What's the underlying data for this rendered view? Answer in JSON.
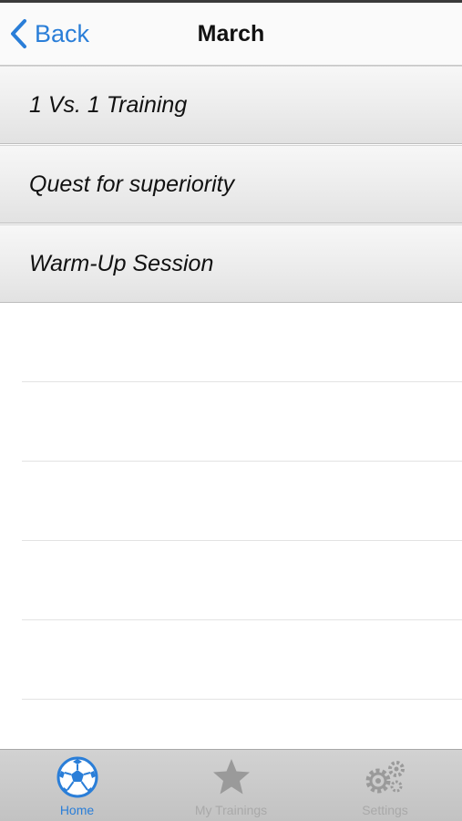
{
  "navbar": {
    "back_label": "Back",
    "title": "March"
  },
  "list": {
    "items": [
      {
        "label": "1 Vs. 1 Training"
      },
      {
        "label": "Quest for superiority"
      },
      {
        "label": "Warm-Up Session"
      }
    ]
  },
  "tabbar": {
    "tabs": [
      {
        "label": "Home",
        "icon": "soccer-ball-icon",
        "active": true
      },
      {
        "label": "My Trainings",
        "icon": "star-icon",
        "active": false
      },
      {
        "label": "Settings",
        "icon": "gears-icon",
        "active": false
      }
    ]
  },
  "colors": {
    "accent": "#2a7ed8",
    "inactive": "#a9a9a9",
    "tabbar_bg": "#c8c8c8"
  }
}
